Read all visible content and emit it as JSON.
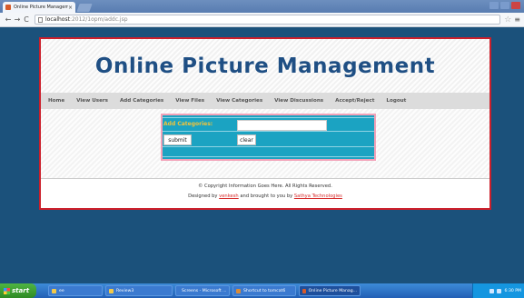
{
  "browser": {
    "tab_title": "Online Picture Management",
    "tab_close": "×",
    "back": "←",
    "forward": "→",
    "reload": "C",
    "url_host": "localhost",
    "url_path": ":2012/1opm/addc.jsp",
    "star": "☆",
    "menu": "≡"
  },
  "site": {
    "title": "Online Picture Management",
    "nav": [
      "Home",
      "View Users",
      "Add Categories",
      "View Files",
      "View Categories",
      "View Discussions",
      "Accept/Reject",
      "Logout"
    ]
  },
  "form": {
    "label": "Add Categories:",
    "input_value": "",
    "submit_label": "submit",
    "clear_label": "clear"
  },
  "footer": {
    "copyright": "© Copyright Information Goes Here. All Rights Reserved.",
    "designed_prefix": "Designed by ",
    "designer": "venkesh",
    "brought_text": " and brought to you by ",
    "company": "Sathya Technologies"
  },
  "taskbar": {
    "start_label": "start",
    "tasks": [
      {
        "label": "ee",
        "color": "#f3c948"
      },
      {
        "label": "Review3",
        "color": "#f3c948"
      },
      {
        "label": "Screens - Microsoft ...",
        "color": "#4a8fe0"
      },
      {
        "label": "Shortcut to tomcat6",
        "color": "#d88c3a"
      },
      {
        "label": "Online Picture Manag...",
        "color": "#d65b2b"
      }
    ],
    "clock": "6:30 PM"
  }
}
